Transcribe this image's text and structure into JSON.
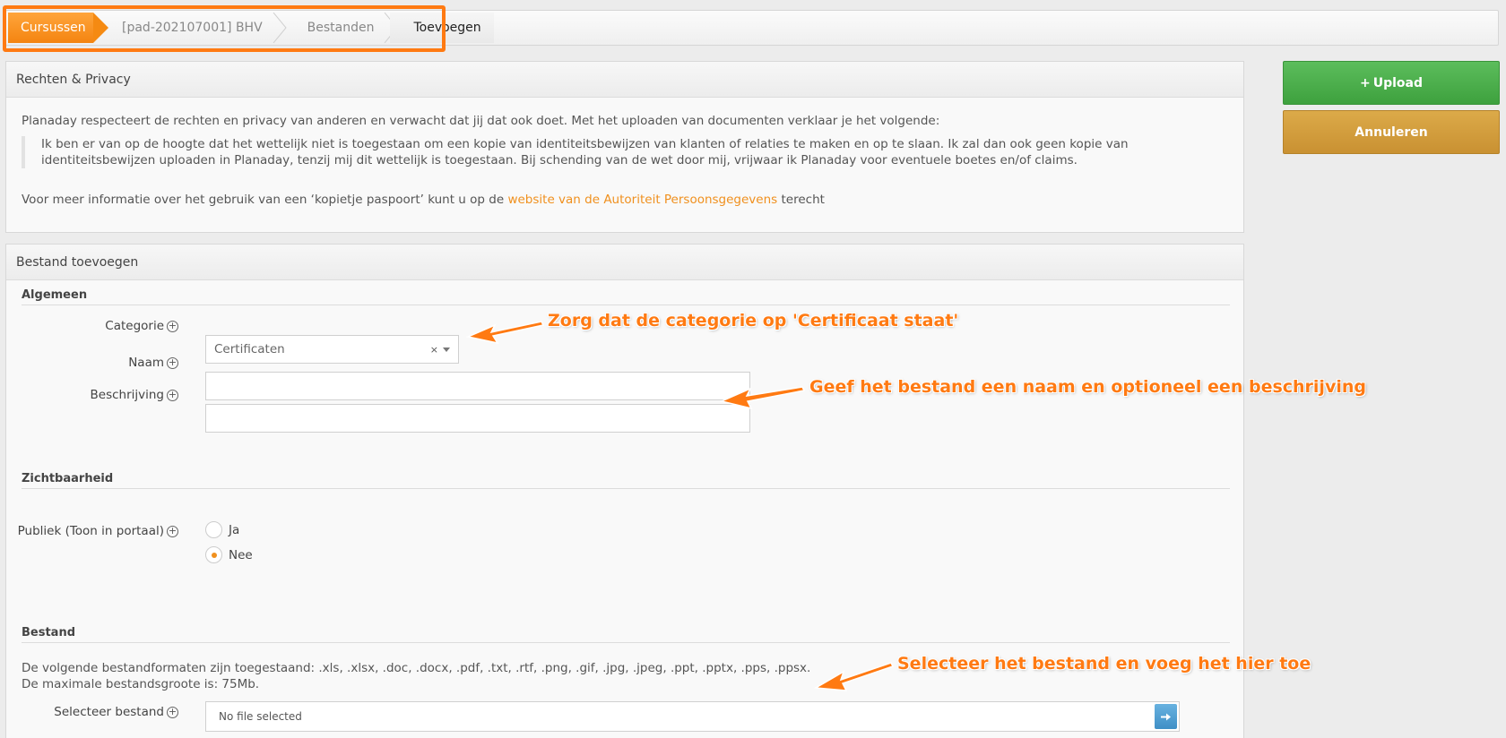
{
  "breadcrumb": {
    "items": [
      "Cursussen",
      "[pad-202107001] BHV",
      "Bestanden",
      "Toevoegen"
    ]
  },
  "buttons": {
    "upload_icon": "+",
    "upload_label": "Upload",
    "cancel_label": "Annuleren"
  },
  "privacy": {
    "title": "Rechten & Privacy",
    "intro": "Planaday respecteert de rechten en privacy van anderen en verwacht dat jij dat ook doet. Met het uploaden van documenten verklaar je het volgende:",
    "quote": "Ik ben er van op de hoogte dat het wettelijk niet is toegestaan om een kopie van identiteitsbewijzen van klanten of relaties te maken en op te slaan. Ik zal dan ook geen kopie van identiteitsbewijzen uploaden in Planaday, tenzij mij dit wettelijk is toegestaan. Bij schending van de wet door mij, vrijwaar ik Planaday voor eventuele boetes en/of claims.",
    "more_prefix": "Voor meer informatie over het gebruik van een ‘kopietje paspoort’ kunt u op de",
    "more_link": "website van de Autoriteit Persoonsgegevens",
    "more_suffix": "terecht"
  },
  "form": {
    "title": "Bestand toevoegen",
    "general_title": "Algemeen",
    "category_label": "Categorie",
    "category_value": "Certificaten",
    "category_clear": "×",
    "name_label": "Naam",
    "name_value": "",
    "description_label": "Beschrijving",
    "description_value": "",
    "visibility_title": "Zichtbaarheid",
    "public_label": "Publiek (Toon in portaal)",
    "radio_yes": "Ja",
    "radio_no": "Nee",
    "radio_selected": "Nee",
    "file_title": "Bestand",
    "formats_line": "De volgende bestandformaten zijn toegestaand: .xls, .xlsx, .doc, .docx, .pdf, .txt, .rtf, .png, .gif, .jpg, .jpeg, .ppt, .pptx, .pps, .ppsx.",
    "max_size_line": "De maximale bestandsgroote is: 75Mb.",
    "file_label": "Selecteer bestand",
    "file_value": "No file selected",
    "expand_icon": "⊕"
  },
  "annotations": {
    "category": "Zorg dat de categorie op 'Certificaat staat'",
    "name": "Geef het bestand een naam en optioneel een beschrijving",
    "file": "Selecteer het bestand en voeg het hier toe"
  },
  "colors": {
    "accent": "#f0901e",
    "annotation": "#ff7a12",
    "upload": "#4cae4c",
    "cancel": "#d19c3c"
  }
}
